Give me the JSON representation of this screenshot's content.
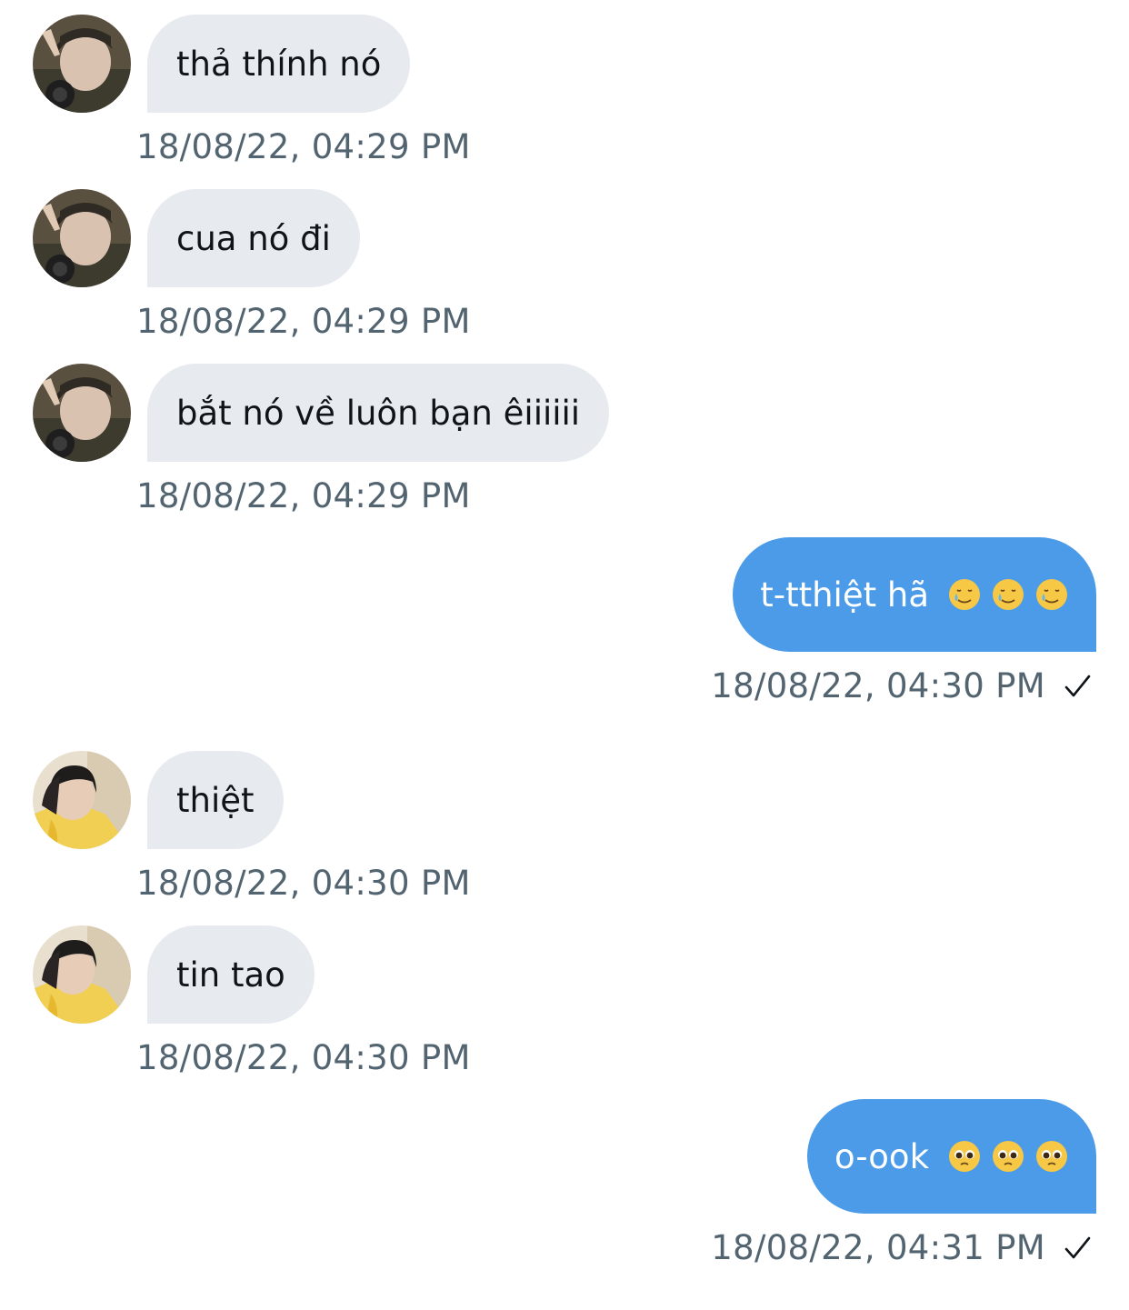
{
  "messages": [
    {
      "text": "thả thính nó",
      "time": "18/08/22, 04:29 PM"
    },
    {
      "text": "cua nó đi",
      "time": "18/08/22, 04:29 PM"
    },
    {
      "text": "bắt nó về luôn bạn êiiiiii",
      "time": "18/08/22, 04:29 PM"
    },
    {
      "text": "t-tthiệt hã",
      "time": "18/08/22, 04:30 PM",
      "emojis": [
        "smiling-face-with-tear",
        "smiling-face-with-tear",
        "smiling-face-with-tear"
      ]
    },
    {
      "text": "thiệt",
      "time": "18/08/22, 04:30 PM"
    },
    {
      "text": "tin tao",
      "time": "18/08/22, 04:30 PM"
    },
    {
      "text": "o-ook",
      "time": "18/08/22, 04:31 PM",
      "emojis": [
        "pleading-face",
        "pleading-face",
        "pleading-face"
      ]
    }
  ],
  "colors": {
    "incoming_bubble": "#e7ebef",
    "outgoing_bubble": "#4c9be8",
    "timestamp": "#536471"
  },
  "icons": {
    "read_receipt": "checkmark-icon",
    "avatar_a": "user-avatar-dark-hair",
    "avatar_b": "user-avatar-yellow-hoodie"
  }
}
